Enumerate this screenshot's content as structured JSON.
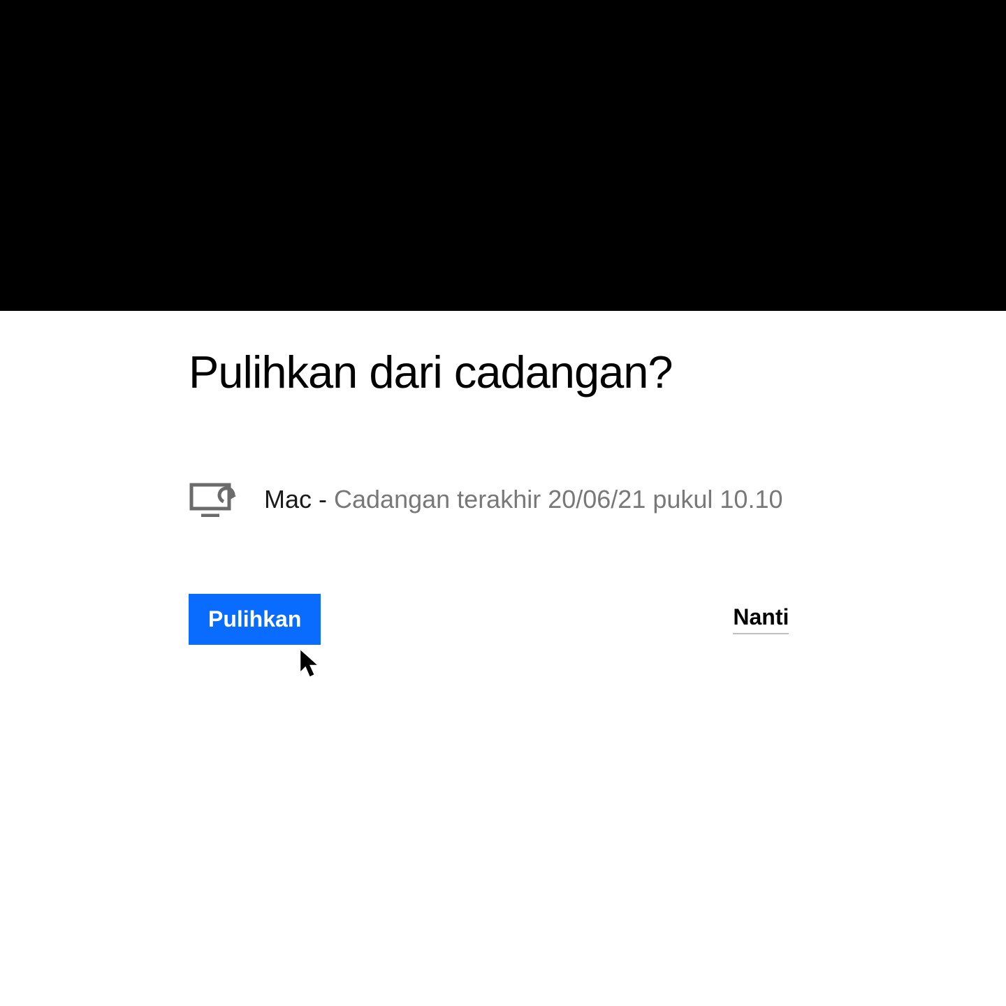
{
  "dialog": {
    "title": "Pulihkan dari cadangan?",
    "backup": {
      "device_name": "Mac",
      "separator": " - ",
      "detail": "Cadangan terakhir 20/06/21 pukul 10.10"
    },
    "buttons": {
      "restore_label": "Pulihkan",
      "later_label": "Nanti"
    }
  },
  "colors": {
    "accent": "#0a6cff",
    "text_primary": "#000000",
    "text_muted": "#787878"
  },
  "icons": {
    "device": "monitor-sync-icon",
    "cursor": "cursor-arrow-icon"
  }
}
